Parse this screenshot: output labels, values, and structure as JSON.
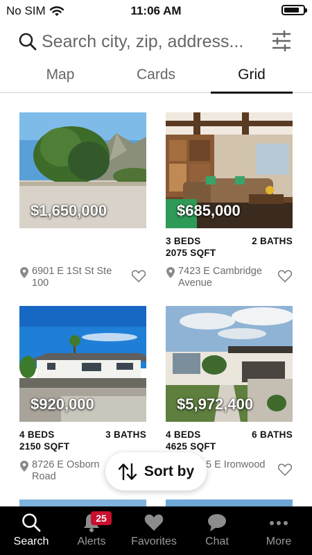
{
  "status_bar": {
    "carrier": "No SIM",
    "time": "11:06 AM",
    "battery_level": 0.8,
    "wifi_icon": "wifi-icon"
  },
  "search": {
    "placeholder": "Search city, zip, address...",
    "icon": "search-icon",
    "filter_icon": "filter-sliders-icon"
  },
  "view_tabs": [
    {
      "label": "Map",
      "active": false
    },
    {
      "label": "Cards",
      "active": false
    },
    {
      "label": "Grid",
      "active": true
    }
  ],
  "listings": [
    {
      "price": "$1,650,000",
      "beds": "",
      "sqft": "",
      "baths": "",
      "address": "6901 E 1St St Ste 100"
    },
    {
      "price": "$685,000",
      "beds": "3 BEDS",
      "sqft": "2075 SQFT",
      "baths": "2 BATHS",
      "address": "7423 E Cambridge Avenue"
    },
    {
      "price": "$920,000",
      "beds": "4 BEDS",
      "sqft": "2150 SQFT",
      "baths": "3 BATHS",
      "address": "8726 E Osborn Road"
    },
    {
      "price": "$5,972,400",
      "beds": "4 BEDS",
      "sqft": "4625 SQFT",
      "baths": "6 BATHS",
      "address": "5 E Ironwood"
    }
  ],
  "sort": {
    "label": "Sort by",
    "icon": "sort-arrows-icon"
  },
  "bottom_tabs": [
    {
      "label": "Search",
      "icon": "search-icon",
      "active": true
    },
    {
      "label": "Alerts",
      "icon": "bell-icon",
      "badge": "25",
      "active": false
    },
    {
      "label": "Favorites",
      "icon": "heart-icon",
      "active": false
    },
    {
      "label": "Chat",
      "icon": "chat-bubble-icon",
      "active": false
    },
    {
      "label": "More",
      "icon": "more-dots-icon",
      "active": false
    }
  ],
  "colors": {
    "accent": "#111111",
    "tab_bar": "#000000",
    "badge": "#c8102e",
    "muted_text": "#6b6b6b"
  }
}
